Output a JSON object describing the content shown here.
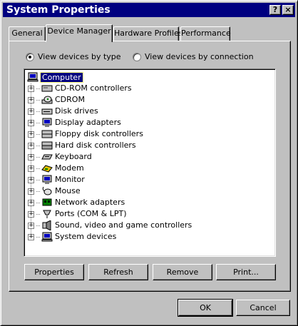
{
  "window": {
    "title": "System Properties"
  },
  "titlebar_buttons": {
    "help": "?",
    "close": "×"
  },
  "tabs": [
    {
      "label": "General",
      "active": false
    },
    {
      "label": "Device Manager",
      "active": true
    },
    {
      "label": "Hardware Profiles",
      "active": false
    },
    {
      "label": "Performance",
      "active": false
    }
  ],
  "view_options": {
    "by_type": {
      "label": "View devices by type",
      "selected": true
    },
    "by_connection": {
      "label": "View devices by connection",
      "selected": false
    }
  },
  "tree": {
    "root": {
      "label": "Computer",
      "icon": "computer-icon",
      "selected": true
    },
    "items": [
      {
        "label": "CD-ROM controllers",
        "icon": "cdrom-controller-icon"
      },
      {
        "label": "CDROM",
        "icon": "cdrom-icon"
      },
      {
        "label": "Disk drives",
        "icon": "disk-drive-icon"
      },
      {
        "label": "Display adapters",
        "icon": "display-adapter-icon"
      },
      {
        "label": "Floppy disk controllers",
        "icon": "floppy-controller-icon"
      },
      {
        "label": "Hard disk controllers",
        "icon": "hard-disk-controller-icon"
      },
      {
        "label": "Keyboard",
        "icon": "keyboard-icon"
      },
      {
        "label": "Modem",
        "icon": "modem-icon"
      },
      {
        "label": "Monitor",
        "icon": "monitor-icon"
      },
      {
        "label": "Mouse",
        "icon": "mouse-icon"
      },
      {
        "label": "Network adapters",
        "icon": "network-adapter-icon"
      },
      {
        "label": "Ports (COM & LPT)",
        "icon": "port-icon"
      },
      {
        "label": "Sound, video and game controllers",
        "icon": "sound-icon"
      },
      {
        "label": "System devices",
        "icon": "system-devices-icon"
      }
    ]
  },
  "panel_buttons": {
    "properties": "Properties",
    "refresh": "Refresh",
    "remove": "Remove",
    "print": "Print..."
  },
  "dialog_buttons": {
    "ok": "OK",
    "cancel": "Cancel"
  },
  "colors": {
    "titlebar": "#000080",
    "face": "#c0c0c0",
    "selection": "#000080"
  }
}
